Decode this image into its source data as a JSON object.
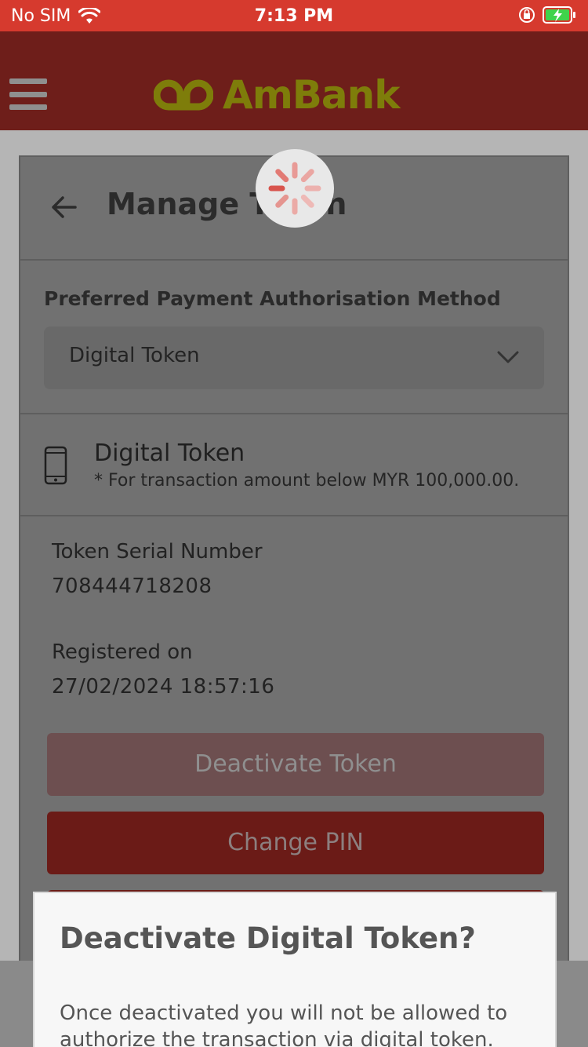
{
  "status_bar": {
    "carrier": "No SIM",
    "time": "7:13 PM"
  },
  "header": {
    "brand": "AmBank"
  },
  "card": {
    "title": "Manage Token",
    "method": {
      "label": "Preferred Payment Authorisation Method",
      "selected": "Digital Token"
    },
    "token": {
      "title": "Digital Token",
      "note": "* For transaction amount below MYR 100,000.00."
    },
    "serial_label": "Token Serial Number",
    "serial_value": "708444718208",
    "registered_label": "Registered on",
    "registered_value": "27/02/2024 18:57:16",
    "buttons": {
      "deactivate": "Deactivate Token",
      "change_pin": "Change PIN"
    }
  },
  "dialog": {
    "title": "Deactivate Digital Token?",
    "body": "Once deactivated you will not be allowed to authorize the transaction via digital token."
  },
  "colors": {
    "status_bar": "#d63a2e",
    "header": "#6e1e1a",
    "logo": "#7e7d0a",
    "primary_button": "#6b1b17"
  }
}
